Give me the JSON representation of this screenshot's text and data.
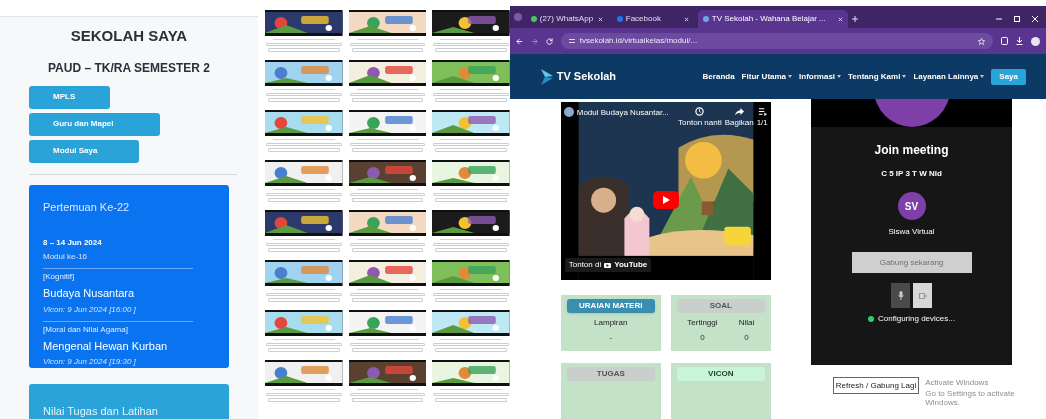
{
  "sekolah": {
    "title": "SEKOLAH SAYA",
    "subtitle": "PAUD – TK/RA SEMESTER 2",
    "buttons": [
      {
        "label": "MPLS"
      },
      {
        "label": "Guru dan Mapel"
      },
      {
        "label": "Modul Saya"
      }
    ],
    "meeting_card": {
      "title": "Pertemuan Ke-22",
      "dates": "8 – 14 Jun 2024",
      "module": "Modul ke-16",
      "items": [
        {
          "subject": "[Kognitif]",
          "title": "Budaya Nusantara",
          "schedule": "Vicon: 9 Jun 2024 [16:00 ]"
        },
        {
          "subject": "[Moral dan Nilai Agama]",
          "title": "Mengenal Hewan Kurban",
          "schedule": "Vicon: 9 Jun 2024 [19:30 ]"
        }
      ]
    },
    "score_card": {
      "title": "Nilai Tugas dan Latihan"
    }
  },
  "browser": {
    "tabs": [
      {
        "label": "(27) WhatsApp",
        "selected": false
      },
      {
        "label": "Facebook",
        "selected": false
      },
      {
        "label": "TV Sekolah - Wahana Belajar ...",
        "selected": true
      }
    ],
    "url": "tvsekolah.id/virtualkelas/modul/...",
    "site": {
      "logo": "TV Sekolah",
      "nav": [
        {
          "label": "Beranda",
          "dropdown": false
        },
        {
          "label": "Fitur Utama",
          "dropdown": true
        },
        {
          "label": "Informasi",
          "dropdown": true
        },
        {
          "label": "Tentang Kami",
          "dropdown": true
        },
        {
          "label": "Layanan Lainnya",
          "dropdown": true
        }
      ],
      "account_button": "Saya"
    },
    "video": {
      "title": "Modul Budaya Nusantar...",
      "actions": [
        {
          "kind": "clock",
          "label": "Tonton nanti"
        },
        {
          "kind": "share",
          "label": "Bagikan"
        },
        {
          "kind": "list",
          "label": "1/1"
        }
      ],
      "watch_on": "Tonton di",
      "brand": "YouTube"
    },
    "cards": [
      {
        "label": "URAIAN MATERI",
        "kind": "active",
        "columns": [
          {
            "header": "Lampiran",
            "value": "-"
          }
        ]
      },
      {
        "label": "SOAL",
        "kind": "inactive",
        "columns": [
          {
            "header": "Tertinggi",
            "value": "0"
          },
          {
            "header": "Nilai",
            "value": "0"
          }
        ]
      },
      {
        "label": "TUGAS",
        "kind": "inactive"
      },
      {
        "label": "VICON",
        "kind": "highlight"
      }
    ],
    "meeting": {
      "title": "Join meeting",
      "code": "C 5 IP 3 T W Nld",
      "initials": "SV",
      "name": "Siswa Virtual",
      "join_button": "Gabung sekarang",
      "status": "Configuring devices..."
    },
    "refresh_button": "Refresh / Gabung Lagi",
    "activation": {
      "title": "Activate Windows",
      "hint": "Go to Settings to activate Windows."
    }
  }
}
